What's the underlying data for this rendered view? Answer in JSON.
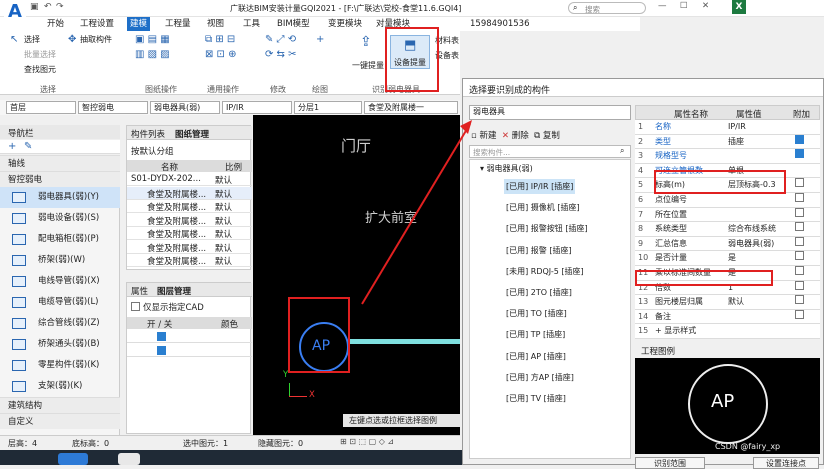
{
  "window": {
    "title": "广联达BIM安装计量GQI2021 - [F:\\广联达\\党校-食堂11.6.GQI4]",
    "search_placeholder": "搜索",
    "account": "15984901536"
  },
  "menu": [
    "开始",
    "工程设置",
    "建模",
    "工程量",
    "视图",
    "工具",
    "BIM模型",
    "变更模块",
    "对量模块"
  ],
  "ribbon": {
    "select": "选择",
    "batch_select": "批量选择",
    "find": "查找图元",
    "pick": "抽取构件",
    "onekey": "一键提量",
    "device": "设备提量",
    "material": "材料表",
    "device_table": "设备表",
    "groups": [
      "选择",
      "图纸操作",
      "通用操作",
      "修改",
      "绘图",
      "识别弱电器具"
    ]
  },
  "propbar": {
    "floor": "首层",
    "major": "智控弱电",
    "type": "弱电器具(弱)",
    "code": "IP/IR",
    "layer": "分层1",
    "part": "食堂及附属楼一"
  },
  "nav": {
    "title": "导航栏",
    "items": [
      {
        "type": "cat",
        "label": "轴线"
      },
      {
        "type": "cat",
        "label": "智控弱电"
      },
      {
        "type": "item",
        "label": "弱电器具(弱)(Y)",
        "sel": true
      },
      {
        "type": "item",
        "label": "弱电设备(弱)(S)"
      },
      {
        "type": "item",
        "label": "配电箱柜(弱)(P)"
      },
      {
        "type": "item",
        "label": "桥架(弱)(W)"
      },
      {
        "type": "item",
        "label": "电线导管(弱)(X)"
      },
      {
        "type": "item",
        "label": "电缆导管(弱)(L)"
      },
      {
        "type": "item",
        "label": "综合管线(弱)(Z)"
      },
      {
        "type": "item",
        "label": "桥架通头(弱)(B)"
      },
      {
        "type": "item",
        "label": "零星构件(弱)(K)"
      },
      {
        "type": "item",
        "label": "支架(弱)(K)"
      },
      {
        "type": "cat",
        "label": "建筑结构"
      },
      {
        "type": "cat",
        "label": "自定义"
      }
    ]
  },
  "comp": {
    "tabs": [
      "构件列表",
      "图纸管理"
    ],
    "group_by": "按默认分组",
    "col_name": "名称",
    "col_ratio": "比例",
    "rows": [
      {
        "name": "S01-DYDX-202...",
        "ratio": "默认"
      },
      {
        "name": "食堂及附属楼...",
        "ratio": "默认"
      },
      {
        "name": "食堂及附属楼...",
        "ratio": "默认"
      },
      {
        "name": "食堂及附属楼...",
        "ratio": "默认"
      },
      {
        "name": "食堂及附属楼...",
        "ratio": "默认"
      },
      {
        "name": "食堂及附属楼...",
        "ratio": "默认"
      },
      {
        "name": "食堂及附属楼...",
        "ratio": "默认"
      }
    ]
  },
  "layer": {
    "tabs": [
      "属性",
      "图层管理"
    ],
    "show_cad": "仅显示指定CAD",
    "col_onoff": "开 / 关",
    "col_color": "颜色"
  },
  "canvas": {
    "text1": "门厅",
    "text2": "扩大前室",
    "symbol": "AP",
    "hint": "左键点选或拉框选择图例"
  },
  "status": {
    "floor": "层高：4",
    "bottom": "底标高：0",
    "selected": "选中图元：1",
    "hidden": "隐藏图元：0"
  },
  "dialog": {
    "title": "选择要识别成的构件",
    "combo": "弱电器具",
    "new": "新建",
    "delete": "删除",
    "copy": "复制",
    "search_placeholder": "搜索构件...",
    "tree_root": "弱电器具(弱)",
    "tree": [
      {
        "label": "[已用] IP/IR [插座]",
        "sel": true
      },
      {
        "label": "[已用] 摄像机 [插座]"
      },
      {
        "label": "[已用] 报警按钮 [插座]"
      },
      {
        "label": "[已用] 报警 [插座]"
      },
      {
        "label": "[未用] RDQJ-5 [插座]"
      },
      {
        "label": "[已用] 2TO [插座]"
      },
      {
        "label": "[已用] TO [插座]"
      },
      {
        "label": "[已用] TP [插座]"
      },
      {
        "label": "[已用] AP [插座]"
      },
      {
        "label": "[已用] 方AP [插座]"
      },
      {
        "label": "[已用] TV [插座]"
      }
    ],
    "prop_headers": [
      "属性名称",
      "属性值",
      "附加"
    ],
    "props": [
      {
        "n": "1",
        "name": "名称",
        "val": "IP/IR",
        "chk": "none"
      },
      {
        "n": "2",
        "name": "类型",
        "val": "插座",
        "chk": "on"
      },
      {
        "n": "3",
        "name": "规格型号",
        "val": "",
        "chk": "on"
      },
      {
        "n": "4",
        "name": "可连立管根数",
        "val": "单根",
        "chk": "none"
      },
      {
        "n": "5",
        "name": "标高(m)",
        "val": "层顶标高-0.3",
        "chk": "off"
      },
      {
        "n": "6",
        "name": "点位编号",
        "val": "",
        "chk": "off"
      },
      {
        "n": "7",
        "name": "所在位置",
        "val": "",
        "chk": "off"
      },
      {
        "n": "8",
        "name": "系统类型",
        "val": "综合布线系统",
        "chk": "off"
      },
      {
        "n": "9",
        "name": "汇总信息",
        "val": "弱电器具(弱)",
        "chk": "off"
      },
      {
        "n": "10",
        "name": "是否计量",
        "val": "是",
        "chk": "off"
      },
      {
        "n": "11",
        "name": "乘以标准间数量",
        "val": "是",
        "chk": "off"
      },
      {
        "n": "12",
        "name": "倍数",
        "val": "1",
        "chk": "off"
      },
      {
        "n": "13",
        "name": "图元楼层归属",
        "val": "默认",
        "chk": "off"
      },
      {
        "n": "14",
        "name": "备注",
        "val": "",
        "chk": "off"
      },
      {
        "n": "15",
        "name": "+ 显示样式",
        "val": "",
        "chk": "none"
      }
    ],
    "legend_title": "工程图例",
    "legend_symbol": "AP",
    "btn_left": "识别范围",
    "btn_right": "设置连接点"
  },
  "watermark": "CSDN @fairy_xp"
}
